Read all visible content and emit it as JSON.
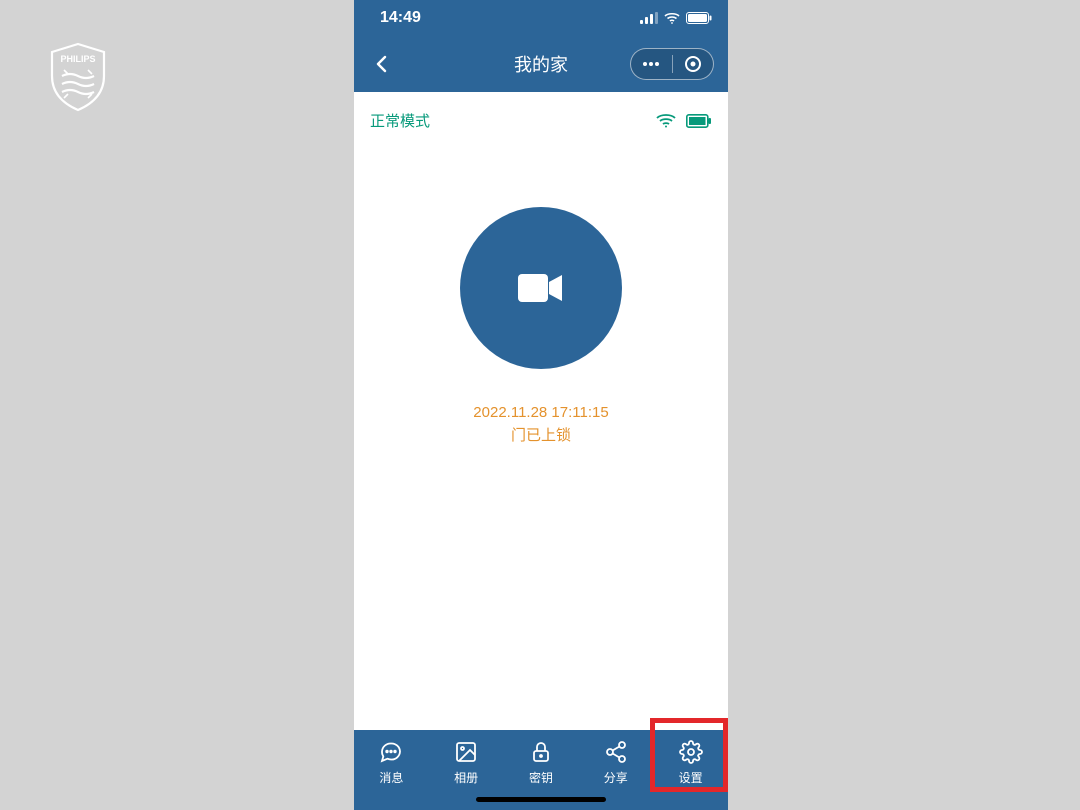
{
  "status": {
    "time": "14:49"
  },
  "nav": {
    "title": "我的家"
  },
  "content": {
    "mode": "正常模式",
    "timestamp": "2022.11.28 17:11:15",
    "lock_status": "门已上锁"
  },
  "tabs": {
    "t0": "消息",
    "t1": "相册",
    "t2": "密钥",
    "t3": "分享",
    "t4": "设置"
  }
}
